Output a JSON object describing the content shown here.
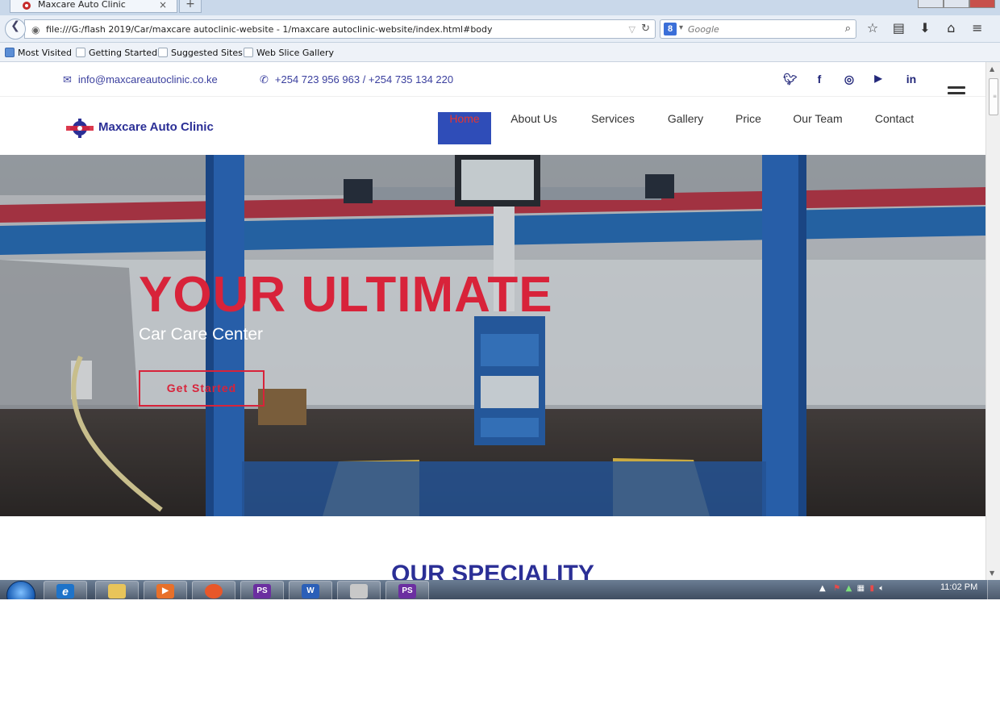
{
  "browser": {
    "tab_title": "Maxcare Auto Clinic",
    "tab_close": "×",
    "new_tab": "+",
    "url": "file:///G:/flash 2019/Car/maxcare autoclinic-website - 1/maxcare autoclinic-website/index.html#body",
    "search_placeholder": "Google",
    "search_engine_letter": "8",
    "bookmarks": [
      "Most Visited",
      "Getting Started",
      "Suggested Sites",
      "Web Slice Gallery"
    ]
  },
  "topbar": {
    "email": "info@maxcareautoclinic.co.ke",
    "phone": "+254 723 956 963 / +254 735 134 220",
    "social": [
      {
        "name": "twitter-icon",
        "glyph": "🐦︎"
      },
      {
        "name": "facebook-icon",
        "glyph": "f"
      },
      {
        "name": "instagram-icon",
        "glyph": "◎"
      },
      {
        "name": "youtube-icon",
        "glyph": "▶"
      },
      {
        "name": "linkedin-icon",
        "glyph": "in"
      }
    ]
  },
  "header": {
    "brand": "Maxcare Auto Clinic",
    "menu": [
      "Home",
      "About Us",
      "Services",
      "Gallery",
      "Price",
      "Our Team",
      "Contact"
    ],
    "active_index": 0
  },
  "hero": {
    "title": "YOUR ULTIMATE",
    "subtitle": "Car Care Center",
    "cta": "Get Started"
  },
  "section": {
    "title": "OUR SPECIALITY"
  },
  "taskbar": {
    "apps": [
      {
        "name": "ie-taskbar-icon",
        "label": "e",
        "color": "#1e73c9"
      },
      {
        "name": "explorer-taskbar-icon",
        "label": "",
        "color": "#e8c45a"
      },
      {
        "name": "media-player-taskbar-icon",
        "label": "▶",
        "color": "#e8702a"
      },
      {
        "name": "firefox-taskbar-icon",
        "label": "",
        "color": "#e8572a"
      },
      {
        "name": "photoshop-taskbar-icon",
        "label": "PS",
        "color": "#6b2fa0"
      },
      {
        "name": "word-taskbar-icon",
        "label": "W",
        "color": "#2b5fb8"
      },
      {
        "name": "graph-taskbar-icon",
        "label": "",
        "color": "#c8c8c8"
      },
      {
        "name": "photoshop-taskbar-icon-2",
        "label": "PS",
        "color": "#6b2fa0"
      }
    ],
    "clock": "11:02 PM"
  },
  "colors": {
    "brand_blue": "#2b2f96",
    "accent_red": "#d8233a",
    "active_menu_bg": "#2f4db8"
  }
}
